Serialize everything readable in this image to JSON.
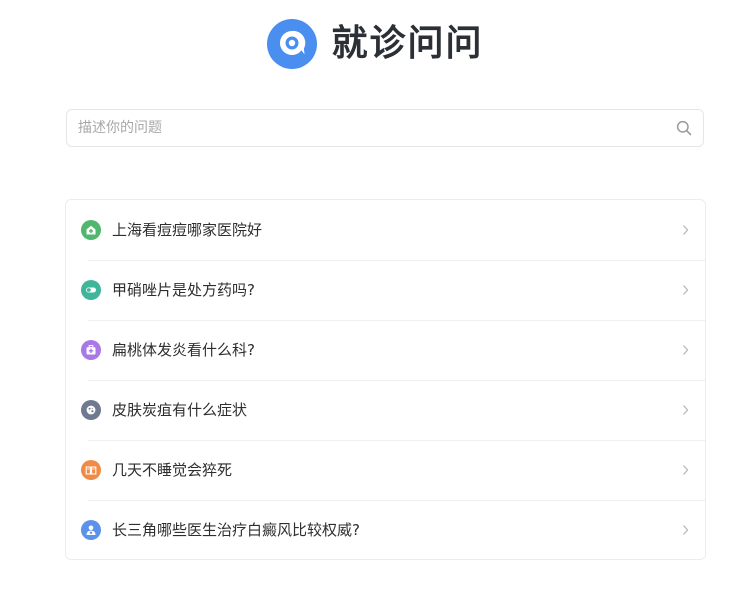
{
  "app": {
    "title": "就诊问问",
    "logo_icon": "chat-bubble-icon",
    "brand_color": "#4a8ff0"
  },
  "search": {
    "placeholder": "描述你的问题",
    "value": "",
    "icon": "search-icon"
  },
  "questions": [
    {
      "text": "上海看痘痘哪家医院好",
      "icon": "hospital-icon",
      "color": "#4fb76e"
    },
    {
      "text": "甲硝唑片是处方药吗?",
      "icon": "pill-icon",
      "color": "#3fb59a"
    },
    {
      "text": "扁桃体发炎看什么科?",
      "icon": "medical-kit-icon",
      "color": "#a878e6"
    },
    {
      "text": "皮肤炭疽有什么症状",
      "icon": "virus-icon",
      "color": "#6f7a90"
    },
    {
      "text": "几天不睡觉会猝死",
      "icon": "book-icon",
      "color": "#ee8b47"
    },
    {
      "text": "长三角哪些医生治疗白癜风比较权威?",
      "icon": "doctor-icon",
      "color": "#5b93ea"
    }
  ]
}
